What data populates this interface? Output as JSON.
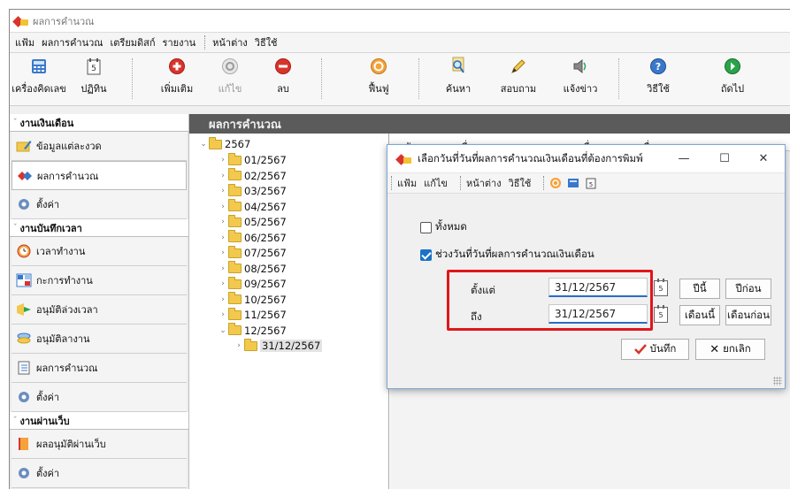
{
  "window": {
    "title": "ผลการคำนวณ"
  },
  "menubar": {
    "items": [
      "แฟ้ม",
      "ผลการคำนวณ",
      "เตรียมดิสก์",
      "รายงาน",
      "หน้าต่าง",
      "วิธีใช้"
    ]
  },
  "toolbar": {
    "calculator": "เครื่องคิดเลข",
    "calendar": "ปฏิทิน",
    "add": "เพิ่มเติม",
    "edit": "แก้ไข",
    "delete": "ลบ",
    "refresh": "ฟื้นฟู",
    "search": "ค้นหา",
    "inquiry": "สอบถาม",
    "news": "แจ้งข่าว",
    "help": "วิธีใช้",
    "next": "ถัดไป"
  },
  "sidebar": {
    "groups": [
      {
        "title": "งานเงินเดือน",
        "items": [
          "ข้อมูลแต่ละงวด",
          "ผลการคำนวณ",
          "ตั้งค่า"
        ]
      },
      {
        "title": "งานบันทึกเวลา",
        "items": [
          "เวลาทำงาน",
          "กะการทำงาน",
          "อนุมัติล่วงเวลา",
          "อนุมัติลางาน",
          "ผลการคำนวณ",
          "ตั้งค่า"
        ]
      },
      {
        "title": "งานผ่านเว็บ",
        "items": [
          "ผลอนุมัติผ่านเว็บ",
          "ตั้งค่า"
        ]
      }
    ]
  },
  "content": {
    "title": "ผลการคำนวณ",
    "tree": {
      "root": "2567",
      "months": [
        "01/2567",
        "02/2567",
        "03/2567",
        "04/2567",
        "05/2567",
        "06/2567",
        "07/2567",
        "08/2567",
        "09/2567",
        "10/2567",
        "11/2567",
        "12/2567"
      ],
      "child": "31/12/2567"
    },
    "grid_headers": [
      "รหัสแผนก",
      "ชื่อแผนก",
      "ชื่อแผนกภาษาอื่น"
    ]
  },
  "dialog": {
    "title": "เลือกวันที่วันที่ผลการคำนวณเงินเดือนที่ต้องการพิมพ์",
    "menubar": [
      "แฟ้ม",
      "แก้ไข",
      "หน้าต่าง",
      "วิธีใช้"
    ],
    "all_label": "ทั้งหมด",
    "all_checked": false,
    "range_label": "ช่วงวันที่วันที่ผลการคำนวณเงินเดือน",
    "range_checked": true,
    "from_label": "ตั้งแต่",
    "from_value": "31/12/2567",
    "to_label": "ถึง",
    "to_value": "31/12/2567",
    "this_year": "ปีนี้",
    "last_year": "ปีก่อน",
    "this_month": "เดือนนี้",
    "last_month": "เดือนก่อน",
    "save": "บันทึก",
    "cancel": "ยกเลิก"
  },
  "colors": {
    "highlight": "#e0161b",
    "accent": "#1a73c8",
    "header_bg": "#5b5b5b"
  }
}
